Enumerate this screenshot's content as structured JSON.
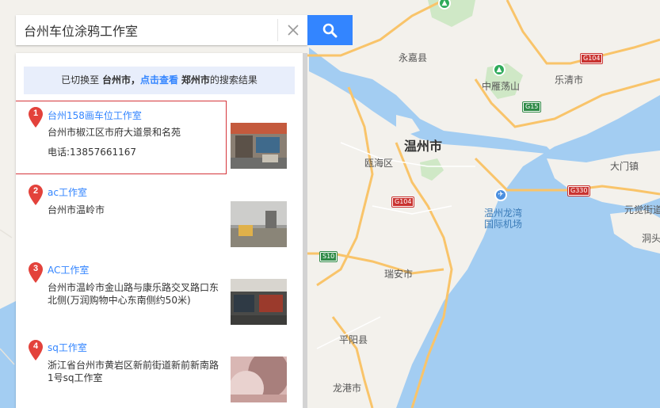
{
  "search": {
    "query": "台州车位涂鸦工作室"
  },
  "notice": {
    "prefix": "已切换至",
    "current_city": "台州市",
    "separator": "，",
    "link_text": "点击查看",
    "other_city": "郑州市",
    "suffix": "的搜索结果"
  },
  "results": [
    {
      "index": "1",
      "title": "台州158画车位工作室",
      "address": "台州市椒江区市府大道景和名苑",
      "phone": "电话:13857661167"
    },
    {
      "index": "2",
      "title": "ac工作室",
      "address": "台州市温岭市",
      "phone": ""
    },
    {
      "index": "3",
      "title": "AC工作室",
      "address": "台州市温岭市金山路与康乐路交叉路口东北侧(万润购物中心东南侧约50米)",
      "phone": ""
    },
    {
      "index": "4",
      "title": "sq工作室",
      "address": "浙江省台州市黄岩区新前街道新前新南路1号sq工作室",
      "phone": ""
    }
  ],
  "map": {
    "places": {
      "yongjia": "永嘉县",
      "yueqing": "乐清市",
      "yandang": "中雁荡山",
      "wenzhou": "温州市",
      "ouhai": "瓯海区",
      "damen": "大门镇",
      "airport_line1": "温州龙湾",
      "airport_line2": "国际机场",
      "yuanjue": "元觉街道",
      "dongtou": "洞头",
      "ruian": "瑞安市",
      "pingyang": "平阳县",
      "longgang": "龙港市"
    },
    "shields": {
      "g104_top": "G104",
      "g15": "G15",
      "g104_mid": "G104",
      "g330": "G330",
      "s10": "S10"
    },
    "colors": {
      "land": "#f3f1ec",
      "water": "#a3cdf2",
      "road": "#f9c46a"
    }
  }
}
